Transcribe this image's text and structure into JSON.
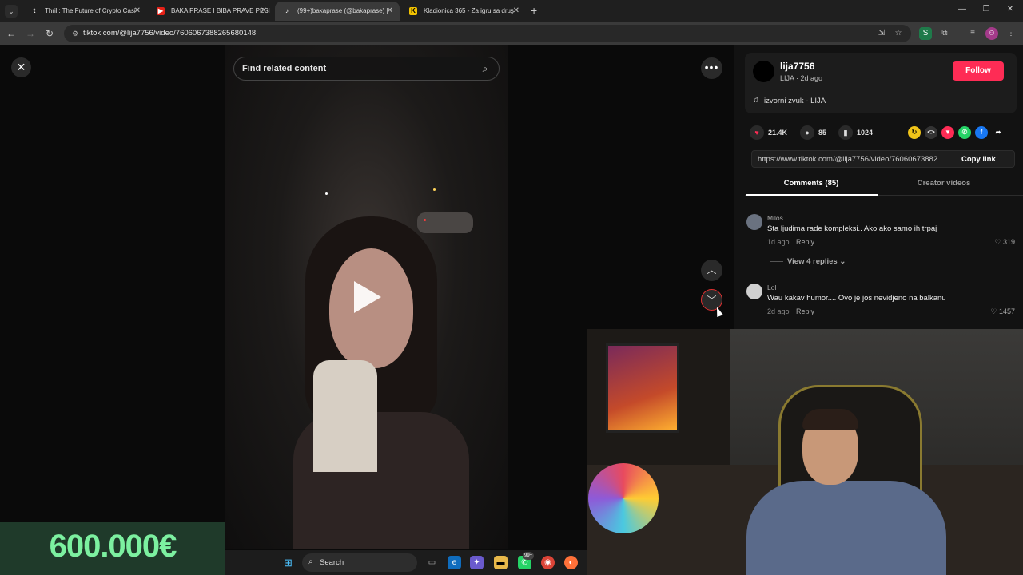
{
  "browser": {
    "tabs": [
      {
        "title": "Thrill: The Future of Crypto Casi",
        "favicon": "t",
        "active": false
      },
      {
        "title": "BAKA PRASE I BIBA PRAVE PESI",
        "favicon": "▶",
        "active": false
      },
      {
        "title": "(99+)bakaprase (@bakaprase) |",
        "favicon": "♪",
        "active": true
      },
      {
        "title": "Kladionica 365 - Za igru sa druş",
        "favicon": "K",
        "active": false
      }
    ],
    "url": "tiktok.com/@lija7756/video/7606067388265680148"
  },
  "video": {
    "search_placeholder": "Find related content"
  },
  "creator": {
    "username": "lija7756",
    "subtitle": "LIJA · 2d ago",
    "follow_label": "Follow",
    "music": "izvorni zvuk - LIJA"
  },
  "stats": {
    "likes": "21.4K",
    "comments": "85",
    "saves": "1024"
  },
  "link": {
    "url": "https://www.tiktok.com/@lija7756/video/76060673882...",
    "copy_label": "Copy link"
  },
  "panel_tabs": {
    "comments": "Comments (85)",
    "creator_videos": "Creator videos"
  },
  "comments": [
    {
      "user": "Milos",
      "text": "Sta ljudima rade kompleksi.. Ako ako samo ih trpaj",
      "time": "1d ago",
      "reply": "Reply",
      "likes": "319"
    },
    {
      "user": "Lol",
      "text": "Wau kakav humor.... Ovo je jos nevidjeno na balkanu",
      "time": "2d ago",
      "reply": "Reply",
      "likes": "1457"
    }
  ],
  "view_replies": "View 4 replies",
  "overlay": {
    "prize": "600.000€"
  },
  "taskbar": {
    "search_label": "Search",
    "badge": "99+"
  },
  "colors": {
    "accent": "#fe2c55",
    "panel_bg": "#121212"
  }
}
